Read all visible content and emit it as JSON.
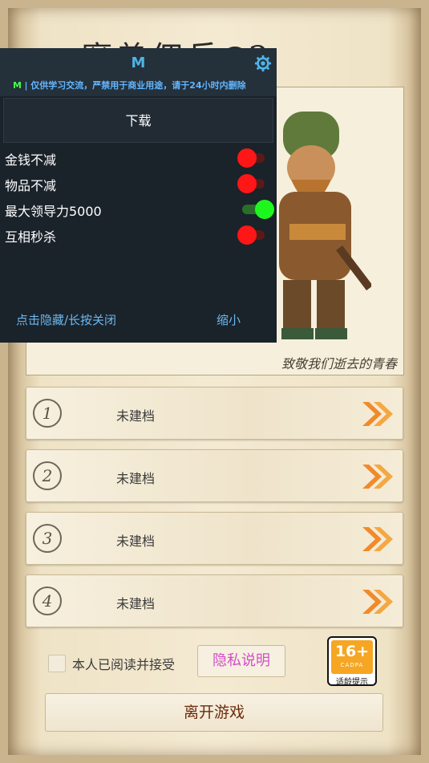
{
  "title_art": {
    "text": "魔兽佣兵",
    "circle_char": "团",
    "suffix": "2"
  },
  "motto": "致敬我们逝去的青春",
  "slots": [
    {
      "number": "1",
      "label": "未建档"
    },
    {
      "number": "2",
      "label": "未建档"
    },
    {
      "number": "3",
      "label": "未建档"
    },
    {
      "number": "4",
      "label": "未建档"
    }
  ],
  "consent": {
    "text": "本人已阅读并接受",
    "checked": false
  },
  "privacy_button": "隐私说明",
  "age_badge": {
    "rating": "16+",
    "org": "CADPA",
    "caption": "适龄提示"
  },
  "exit_button": "离开游戏",
  "overlay": {
    "title": "M",
    "notice_prefix": "M",
    "notice_text": "| 仅供学习交流，严禁用于商业用途，请于24小时内删除",
    "download_label": "下载",
    "options": [
      {
        "label": "金钱不减",
        "enabled": false
      },
      {
        "label": "物品不减",
        "enabled": false
      },
      {
        "label": "最大领导力5000",
        "enabled": true
      },
      {
        "label": "互相秒杀",
        "enabled": false
      }
    ],
    "hide_label": "点击隐藏/长按关闭",
    "minimize_label": "缩小"
  },
  "colors": {
    "accent_blue": "#4fb3e6",
    "toggle_on": "#1ef71e",
    "toggle_off": "#ff1616",
    "privacy_pink": "#d14fc7",
    "badge_orange": "#f6a623"
  }
}
